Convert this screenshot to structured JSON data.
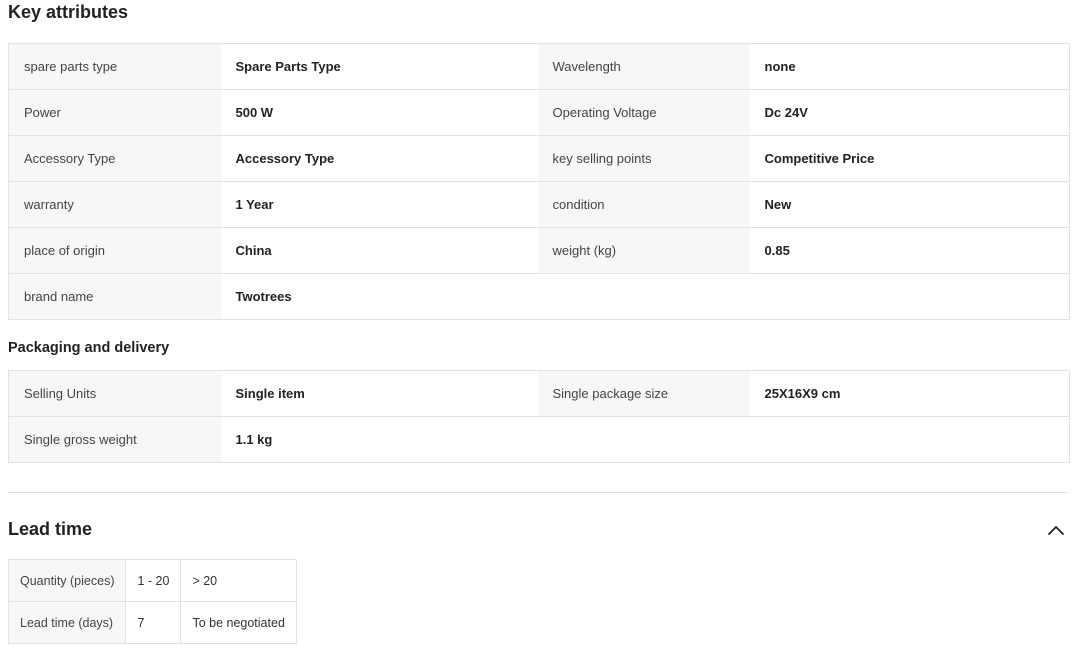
{
  "key_attributes": {
    "title": "Key attributes",
    "rows": [
      [
        {
          "k": "spare parts type",
          "v": "Spare Parts Type"
        },
        {
          "k": "Wavelength",
          "v": "none"
        }
      ],
      [
        {
          "k": "Power",
          "v": "500 W"
        },
        {
          "k": "Operating Voltage",
          "v": "Dc 24V"
        }
      ],
      [
        {
          "k": "Accessory Type",
          "v": "Accessory Type"
        },
        {
          "k": "key selling points",
          "v": "Competitive Price"
        }
      ],
      [
        {
          "k": "warranty",
          "v": "1 Year"
        },
        {
          "k": "condition",
          "v": "New"
        }
      ],
      [
        {
          "k": "place of origin",
          "v": "China"
        },
        {
          "k": "weight (kg)",
          "v": "0.85"
        }
      ],
      [
        {
          "k": "brand name",
          "v": "Twotrees"
        }
      ]
    ]
  },
  "packaging": {
    "title": "Packaging and delivery",
    "rows": [
      [
        {
          "k": "Selling Units",
          "v": "Single item"
        },
        {
          "k": "Single package size",
          "v": "25X16X9 cm"
        }
      ],
      [
        {
          "k": "Single gross weight",
          "v": "1.1 kg"
        }
      ]
    ]
  },
  "lead_time": {
    "title": "Lead time",
    "toggle_icon": "chevron-up-icon",
    "quantity_label": "Quantity (pieces)",
    "days_label": "Lead time (days)",
    "columns": [
      {
        "quantity": "1 - 20",
        "days": "7"
      },
      {
        "quantity": "> 20",
        "days": "To be negotiated"
      }
    ]
  }
}
